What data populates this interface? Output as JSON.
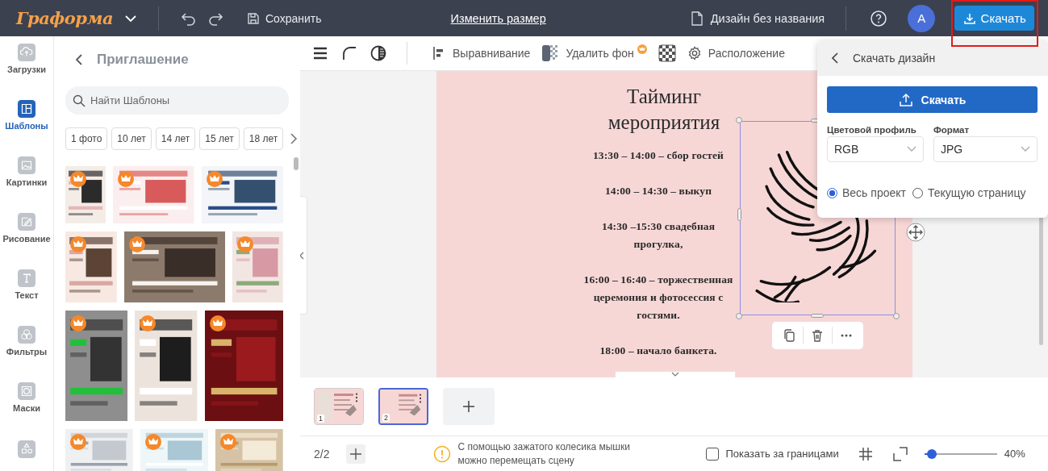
{
  "topbar": {
    "logo": "Граформа",
    "save": "Сохранить",
    "resize": "Изменить размер",
    "doc_title": "Дизайн без названия",
    "avatar": "A",
    "download": "Скачать"
  },
  "rail": [
    {
      "label": "Загрузки",
      "selected": false
    },
    {
      "label": "Шаблоны",
      "selected": true
    },
    {
      "label": "Картинки",
      "selected": false
    },
    {
      "label": "Рисование",
      "selected": false
    },
    {
      "label": "Текст",
      "selected": false
    },
    {
      "label": "Фильтры",
      "selected": false
    },
    {
      "label": "Маски",
      "selected": false
    }
  ],
  "templates_panel": {
    "title": "Приглашение",
    "search": {
      "placeholder": "Найти Шаблоны"
    },
    "chips": [
      "1 фото",
      "10 лет",
      "14 лет",
      "15 лет",
      "18 лет"
    ],
    "templates": [
      [
        {
          "kind": "picture",
          "premium": true
        },
        {
          "kind": "picture",
          "premium": true
        },
        {
          "kind": "picture",
          "premium": true
        }
      ],
      [
        {
          "kind": "picture",
          "premium": true
        },
        {
          "kind": "picture",
          "premium": true
        },
        {
          "kind": "picture",
          "premium": true
        }
      ],
      [
        {
          "kind": "picture",
          "premium": true
        },
        {
          "kind": "picture",
          "premium": true
        },
        {
          "kind": "picture",
          "premium": true
        }
      ],
      [
        {
          "kind": "picture",
          "premium": true
        },
        {
          "kind": "picture",
          "premium": true
        },
        {
          "kind": "picture",
          "premium": true
        }
      ]
    ]
  },
  "toolbar": {
    "align": "Выравнивание",
    "remove_bg": {
      "label": "Удалить фон",
      "premium": true
    },
    "arrange": "Расположение"
  },
  "design_page": {
    "title": "Тайминг мероприятия",
    "schedule": [
      "13:30 – 14:00 – сбор гостей",
      "14:00 – 14:30 – выкуп",
      "14:30 –15:30 свадебная прогулка,",
      "16:00 – 16:40 – торжественная церемония и фотосессия с гостями.",
      "18:00 – начало банкета."
    ]
  },
  "pages": [
    {
      "number": "1",
      "selected": false
    },
    {
      "number": "2",
      "selected": true
    }
  ],
  "bottom_bar": {
    "page_count": "2/2",
    "hint": "С помощью зажатого колесика мышки можно перемещать сцену",
    "show_outside": {
      "label": "Показать за границами",
      "checked": false
    },
    "zoom": {
      "level": 0.1,
      "reading": "40%"
    }
  },
  "download_panel": {
    "title": "Скачать дизайн",
    "button": "Скачать",
    "color_profile": {
      "label": "Цветовой профиль",
      "value": "RGB"
    },
    "format": {
      "label": "Формат",
      "value": "JPG"
    },
    "scope": [
      {
        "label": "Весь проект",
        "selected": true
      },
      {
        "label": "Текущую страницу",
        "selected": false
      }
    ]
  }
}
